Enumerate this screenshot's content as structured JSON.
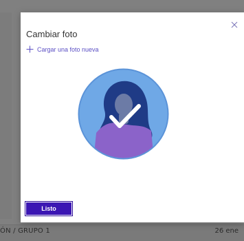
{
  "dialog": {
    "title": "Cambiar foto",
    "upload_label": "Cargar una foto nueva",
    "done_label": "Listo",
    "icons": {
      "close": "close-icon",
      "plus": "plus-icon",
      "avatar_check": "checkmark-icon"
    }
  },
  "background": {
    "left_text": "ÓN / GRUPO 1",
    "right_text": "26 ene"
  },
  "colors": {
    "accent": "#5b4fc4",
    "button": "#3b16b3",
    "avatar_circle": "#6fa8e6",
    "avatar_hair": "#1f3b86",
    "avatar_body": "#8b63c9"
  }
}
